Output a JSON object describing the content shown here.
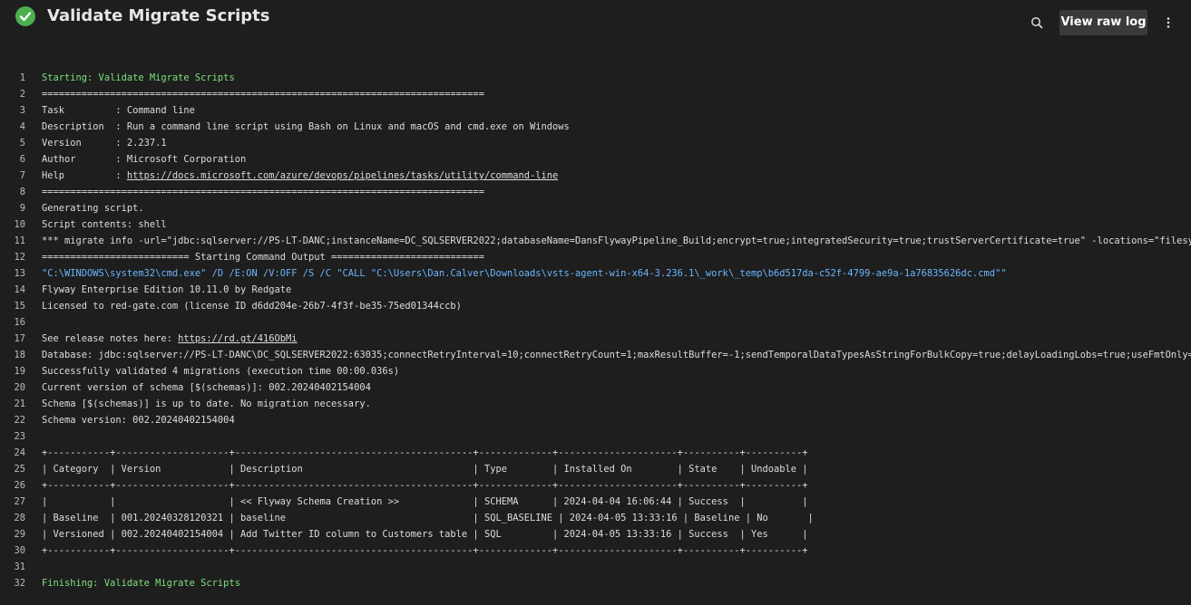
{
  "header": {
    "title": "Validate Migrate Scripts",
    "view_raw_log_label": "View raw log",
    "status_color": "#4caf50"
  },
  "log": {
    "lines": [
      {
        "n": "1",
        "text": "Starting: Validate Migrate Scripts",
        "style": "green"
      },
      {
        "n": "2",
        "text": "==============================================================================",
        "style": ""
      },
      {
        "n": "3",
        "text": "Task         : Command line",
        "style": ""
      },
      {
        "n": "4",
        "text": "Description  : Run a command line script using Bash on Linux and macOS and cmd.exe on Windows",
        "style": ""
      },
      {
        "n": "5",
        "text": "Version      : 2.237.1",
        "style": ""
      },
      {
        "n": "6",
        "text": "Author       : Microsoft Corporation",
        "style": ""
      },
      {
        "n": "7",
        "text": "Help         : ",
        "link": "https://docs.microsoft.com/azure/devops/pipelines/tasks/utility/command-line",
        "style": ""
      },
      {
        "n": "8",
        "text": "==============================================================================",
        "style": ""
      },
      {
        "n": "9",
        "text": "Generating script.",
        "style": ""
      },
      {
        "n": "10",
        "text": "Script contents: shell",
        "style": ""
      },
      {
        "n": "11",
        "text": "*** migrate info -url=\"jdbc:sqlserver://PS-LT-DANC;instanceName=DC_SQLSERVER2022;databaseName=DansFlywayPipeline_Build;encrypt=true;integratedSecurity=true;trustServerCertificate=true\" -locations=\"filesystem:C:\\Users\\Dan.Calver\\Downloads\\vsts-agent",
        "style": ""
      },
      {
        "n": "12",
        "text": "========================== Starting Command Output ===========================",
        "style": ""
      },
      {
        "n": "13",
        "text": "\"C:\\WINDOWS\\system32\\cmd.exe\" /D /E:ON /V:OFF /S /C \"CALL \"C:\\Users\\Dan.Calver\\Downloads\\vsts-agent-win-x64-3.236.1\\_work\\_temp\\b6d517da-c52f-4799-ae9a-1a76835626dc.cmd\"\"",
        "style": "blue"
      },
      {
        "n": "14",
        "text": "Flyway Enterprise Edition 10.11.0 by Redgate",
        "style": ""
      },
      {
        "n": "15",
        "text": "Licensed to red-gate.com (license ID d6dd204e-26b7-4f3f-be35-75ed01344ccb)",
        "style": ""
      },
      {
        "n": "16",
        "text": "",
        "style": ""
      },
      {
        "n": "17",
        "text": "See release notes here: ",
        "link": "https://rd.gt/416ObMi",
        "style": ""
      },
      {
        "n": "18",
        "text": "Database: jdbc:sqlserver://PS-LT-DANC\\DC_SQLSERVER2022:63035;connectRetryInterval=10;connectRetryCount=1;maxResultBuffer=-1;sendTemporalDataTypesAsStringForBulkCopy=true;delayLoadingLobs=true;useFmtOnly=false;useBulkCopyForBatchInsert=false",
        "style": ""
      },
      {
        "n": "19",
        "text": "Successfully validated 4 migrations (execution time 00:00.036s)",
        "style": ""
      },
      {
        "n": "20",
        "text": "Current version of schema [$(schemas)]: 002.20240402154004",
        "style": ""
      },
      {
        "n": "21",
        "text": "Schema [$(schemas)] is up to date. No migration necessary.",
        "style": ""
      },
      {
        "n": "22",
        "text": "Schema version: 002.20240402154004",
        "style": ""
      },
      {
        "n": "23",
        "text": "",
        "style": ""
      },
      {
        "n": "24",
        "text": "+-----------+--------------------+------------------------------------------+-------------+---------------------+----------+----------+",
        "style": ""
      },
      {
        "n": "25",
        "text": "| Category  | Version            | Description                              | Type        | Installed On        | State    | Undoable |",
        "style": ""
      },
      {
        "n": "26",
        "text": "+-----------+--------------------+------------------------------------------+-------------+---------------------+----------+----------+",
        "style": ""
      },
      {
        "n": "27",
        "text": "|           |                    | << Flyway Schema Creation >>             | SCHEMA      | 2024-04-04 16:06:44 | Success  |          |",
        "style": ""
      },
      {
        "n": "28",
        "text": "| Baseline  | 001.20240328120321 | baseline                                 | SQL_BASELINE | 2024-04-05 13:33:16 | Baseline | No       |",
        "style": ""
      },
      {
        "n": "29",
        "text": "| Versioned | 002.20240402154004 | Add Twitter ID column to Customers table | SQL         | 2024-04-05 13:33:16 | Success  | Yes      |",
        "style": ""
      },
      {
        "n": "30",
        "text": "+-----------+--------------------+------------------------------------------+-------------+---------------------+----------+----------+",
        "style": ""
      },
      {
        "n": "31",
        "text": "",
        "style": ""
      },
      {
        "n": "32",
        "text": "Finishing: Validate Migrate Scripts",
        "style": "green"
      }
    ]
  }
}
